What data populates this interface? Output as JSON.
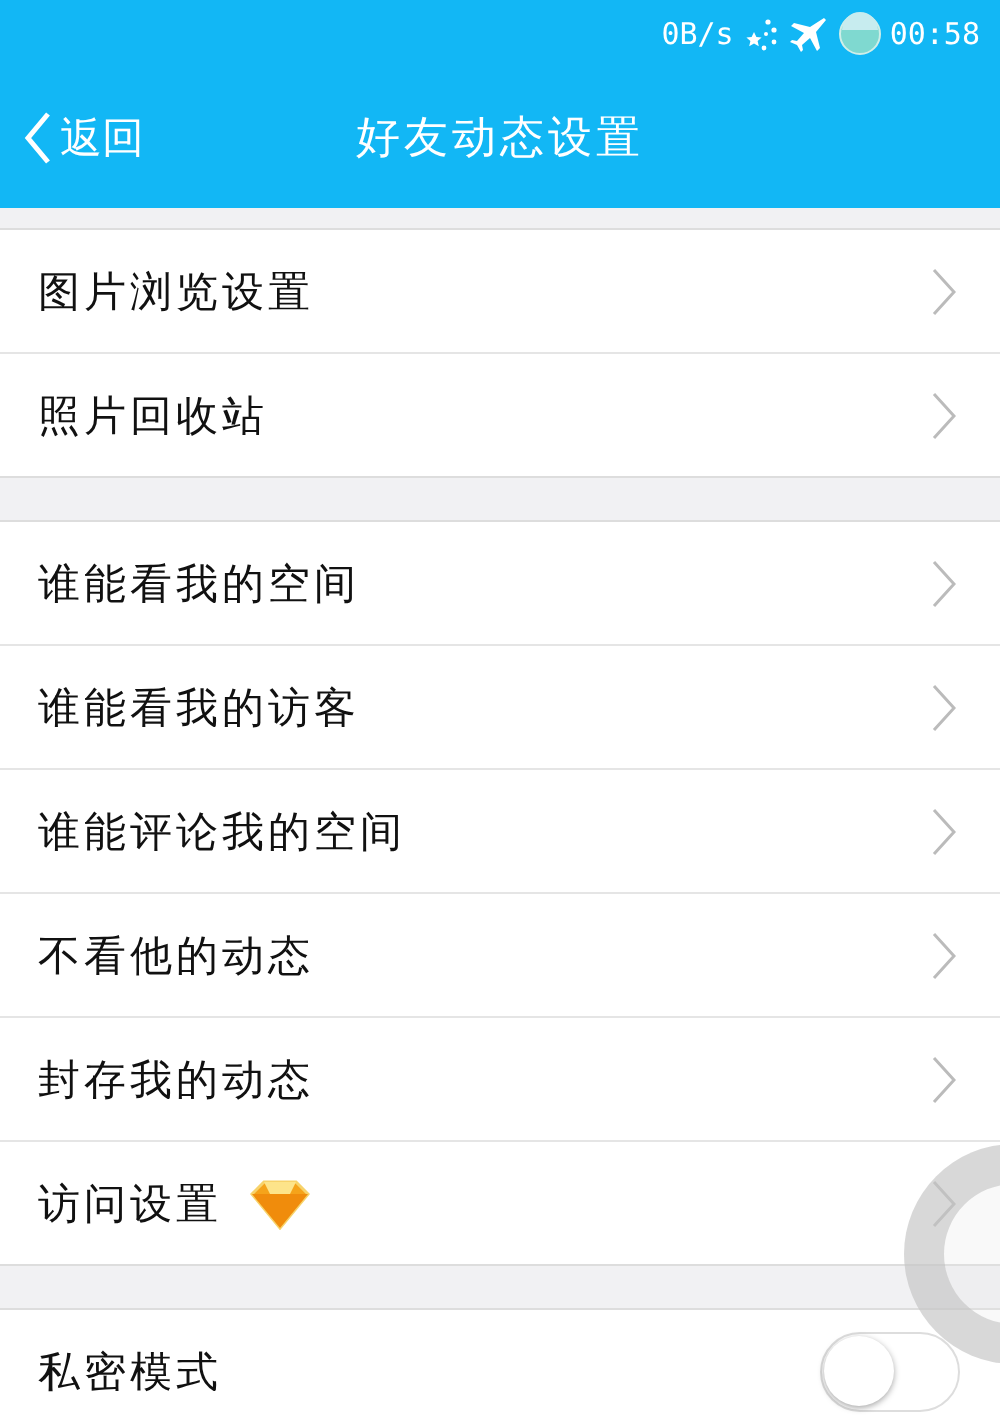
{
  "status_bar": {
    "speed": "0B/s",
    "time": "00:58"
  },
  "header": {
    "back": "返回",
    "title": "好友动态设置"
  },
  "sections": [
    {
      "rows": [
        {
          "kind": "link",
          "label": "图片浏览设置",
          "vip": false
        },
        {
          "kind": "link",
          "label": "照片回收站",
          "vip": false
        }
      ]
    },
    {
      "rows": [
        {
          "kind": "link",
          "label": "谁能看我的空间",
          "vip": false
        },
        {
          "kind": "link",
          "label": "谁能看我的访客",
          "vip": false
        },
        {
          "kind": "link",
          "label": "谁能评论我的空间",
          "vip": false
        },
        {
          "kind": "link",
          "label": "不看他的动态",
          "vip": false
        },
        {
          "kind": "link",
          "label": "封存我的动态",
          "vip": false
        },
        {
          "kind": "link",
          "label": "访问设置",
          "vip": true
        }
      ]
    },
    {
      "rows": [
        {
          "kind": "toggle",
          "label": "私密模式",
          "on": false
        }
      ]
    }
  ]
}
